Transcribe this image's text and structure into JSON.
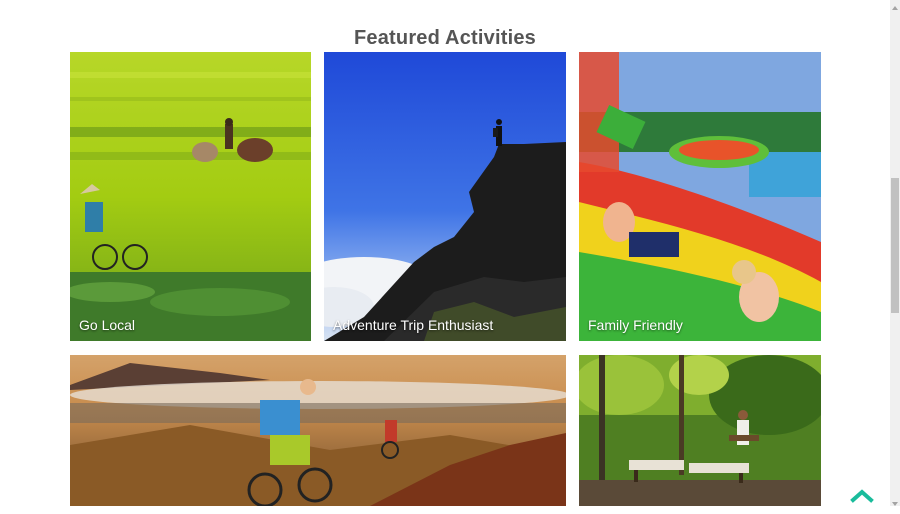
{
  "section": {
    "title": "Featured Activities"
  },
  "cards": [
    {
      "label": "Go Local",
      "scene": "rice-field-farmer"
    },
    {
      "label": "Adventure Trip Enthusiast",
      "scene": "mountain-cliff-hiker"
    },
    {
      "label": "Family Friendly",
      "scene": "waterpark-slide"
    },
    {
      "label": "",
      "scene": "mountain-biking-sunset"
    },
    {
      "label": "",
      "scene": "jungle-spa-loungers"
    }
  ],
  "colors": {
    "title": "#555555",
    "accent": "#1abc9c",
    "scrollbar_track": "#f0f0f0",
    "scrollbar_thumb": "#c1c1c1"
  },
  "icons": {
    "back_to_top": "chevron-up-icon",
    "scroll_up": "scroll-up-arrow-icon",
    "scroll_down": "scroll-down-arrow-icon"
  }
}
